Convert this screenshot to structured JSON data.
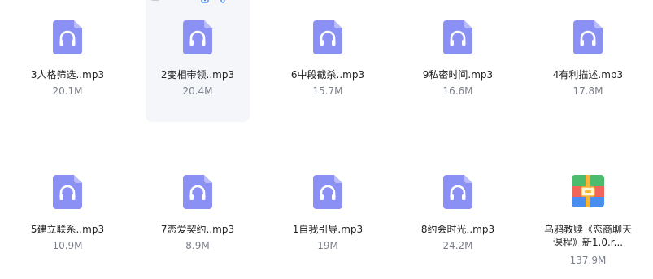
{
  "files": [
    {
      "name": "3人格筛选..mp3",
      "size": "20.1M",
      "icon": "audio-file-icon"
    },
    {
      "name": "2变相带领..mp3",
      "size": "20.4M",
      "icon": "audio-file-icon"
    },
    {
      "name": "6中段截杀..mp3",
      "size": "15.7M",
      "icon": "audio-file-icon"
    },
    {
      "name": "9私密时间.mp3",
      "size": "16.6M",
      "icon": "audio-file-icon"
    },
    {
      "name": "4有利描述.mp3",
      "size": "17.8M",
      "icon": "audio-file-icon"
    },
    {
      "name": "5建立联系..mp3",
      "size": "10.9M",
      "icon": "audio-file-icon"
    },
    {
      "name": "7恋爱契约..mp3",
      "size": "8.9M",
      "icon": "audio-file-icon"
    },
    {
      "name": "1自我引导.mp3",
      "size": "19M",
      "icon": "audio-file-icon"
    },
    {
      "name": "8约会时光..mp3",
      "size": "24.2M",
      "icon": "audio-file-icon"
    },
    {
      "name": "乌鸦教赎《恋商聊天课程》新1.0.r...",
      "size": "137.9M",
      "icon": "archive-file-icon"
    }
  ],
  "hover_tools": [
    "checkbox",
    "phone-icon",
    "share-icon",
    "more-icon"
  ],
  "colors": {
    "audio_icon": "#8b90f5",
    "audio_icon_fold": "#b9bcfa",
    "archive_green": "#4cbb6b",
    "archive_red": "#f0665a",
    "archive_blue": "#4a8df0",
    "archive_band": "#f4b73a",
    "tool_blue": "#3b82f6"
  }
}
